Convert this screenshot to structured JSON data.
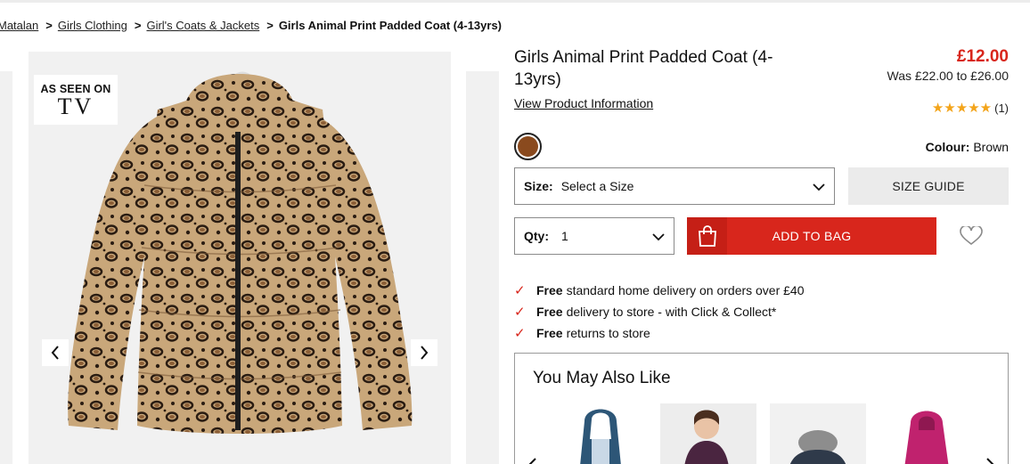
{
  "breadcrumb": {
    "items": [
      "Matalan",
      "Girls Clothing",
      "Girl's Coats & Jackets"
    ],
    "separator": ">",
    "current": "Girls Animal Print Padded Coat (4-13yrs)"
  },
  "gallery": {
    "badge_line1": "AS SEEN ON",
    "badge_line2": "TV",
    "prev_icon": "chevron-left-icon",
    "next_icon": "chevron-right-icon"
  },
  "product": {
    "title": "Girls Animal Print Padded Coat (4-13yrs)",
    "price": "£12.00",
    "was_price": "Was £22.00 to £26.00",
    "view_info": "View Product Information",
    "stars": "★★★★★",
    "rating_count": "(1)",
    "colour_label": "Colour:",
    "colour_value": "Brown",
    "swatch_color": "#8a4a1e",
    "price_color": "#d8261c"
  },
  "size": {
    "label": "Size:",
    "value": "Select a Size",
    "guide_label": "SIZE GUIDE"
  },
  "qty": {
    "label": "Qty:",
    "value": "1"
  },
  "cart": {
    "add_label": "ADD TO BAG",
    "bag_icon": "shopping-bag-icon",
    "wishlist_icon": "heart-icon"
  },
  "delivery": [
    {
      "bold": "Free",
      "text": "standard home delivery on orders over £40"
    },
    {
      "bold": "Free",
      "text": "delivery to store - with Click & Collect*"
    },
    {
      "bold": "Free",
      "text": "returns to store"
    }
  ],
  "recommendations": {
    "heading": "You May Also Like"
  }
}
